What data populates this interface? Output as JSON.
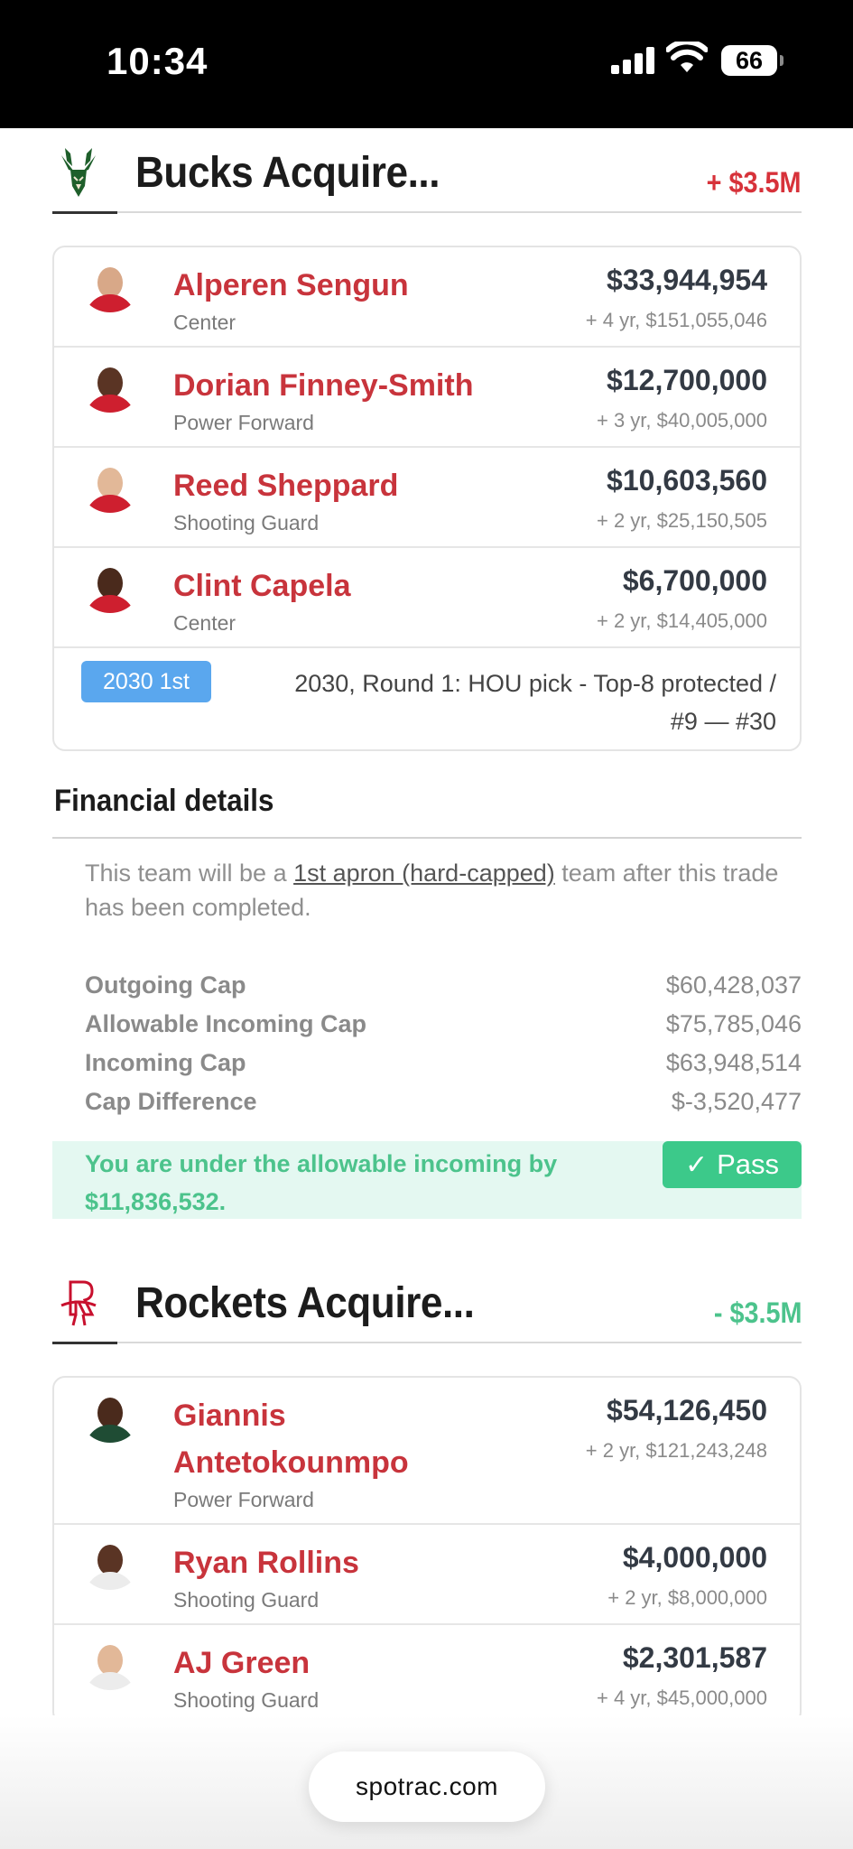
{
  "status_bar": {
    "time": "10:34",
    "battery": "66"
  },
  "bucks_section": {
    "title": "Bucks Acquire...",
    "delta": "+ $3.5M",
    "delta_color": "#d7323a",
    "players": [
      {
        "name": "Alperen Sengun",
        "position": "Center",
        "salary": "$33,944,954",
        "extension": "+ 4 yr, $151,055,046"
      },
      {
        "name": "Dorian Finney-Smith",
        "position": "Power Forward",
        "salary": "$12,700,000",
        "extension": "+ 3 yr, $40,005,000"
      },
      {
        "name": "Reed Sheppard",
        "position": "Shooting Guard",
        "salary": "$10,603,560",
        "extension": "+ 2 yr, $25,150,505"
      },
      {
        "name": "Clint Capela",
        "position": "Center",
        "salary": "$6,700,000",
        "extension": "+ 2 yr, $14,405,000"
      }
    ],
    "pick": {
      "badge": "2030 1st",
      "description": "2030, Round 1: HOU pick - Top-8 protected / #9 — #30"
    }
  },
  "financial_details": {
    "title": "Financial details",
    "note_prefix": "This team will be a ",
    "note_link": "1st apron (hard-capped)",
    "note_suffix": " team after this trade has been completed.",
    "rows": [
      {
        "label": "Outgoing Cap",
        "value": "$60,428,037"
      },
      {
        "label": "Allowable Incoming Cap",
        "value": "$75,785,046"
      },
      {
        "label": "Incoming Cap",
        "value": "$63,948,514"
      },
      {
        "label": "Cap Difference",
        "value": "$-3,520,477"
      }
    ],
    "result_text": "You are under the allowable incoming by $11,836,532.",
    "result_badge": "Pass",
    "pass_color": "#3cc98a"
  },
  "rockets_section": {
    "title": "Rockets Acquire...",
    "delta": "- $3.5M",
    "delta_color": "#4cc38c",
    "players": [
      {
        "name": "Giannis Antetokounmpo",
        "position": "Power Forward",
        "salary": "$54,126,450",
        "extension": "+ 2 yr, $121,243,248"
      },
      {
        "name": "Ryan Rollins",
        "position": "Shooting Guard",
        "salary": "$4,000,000",
        "extension": "+ 2 yr, $8,000,000"
      },
      {
        "name": "AJ Green",
        "position": "Shooting Guard",
        "salary": "$2,301,587",
        "extension": "+ 4 yr, $45,000,000"
      }
    ]
  },
  "watermark": "spotrac.com",
  "icons": {
    "bucks_logo": "deer-antlers-icon",
    "rockets_logo": "rocket-r-icon",
    "signal": "cell-signal-icon",
    "wifi": "wifi-icon",
    "battery": "battery-icon",
    "check": "check-icon"
  }
}
